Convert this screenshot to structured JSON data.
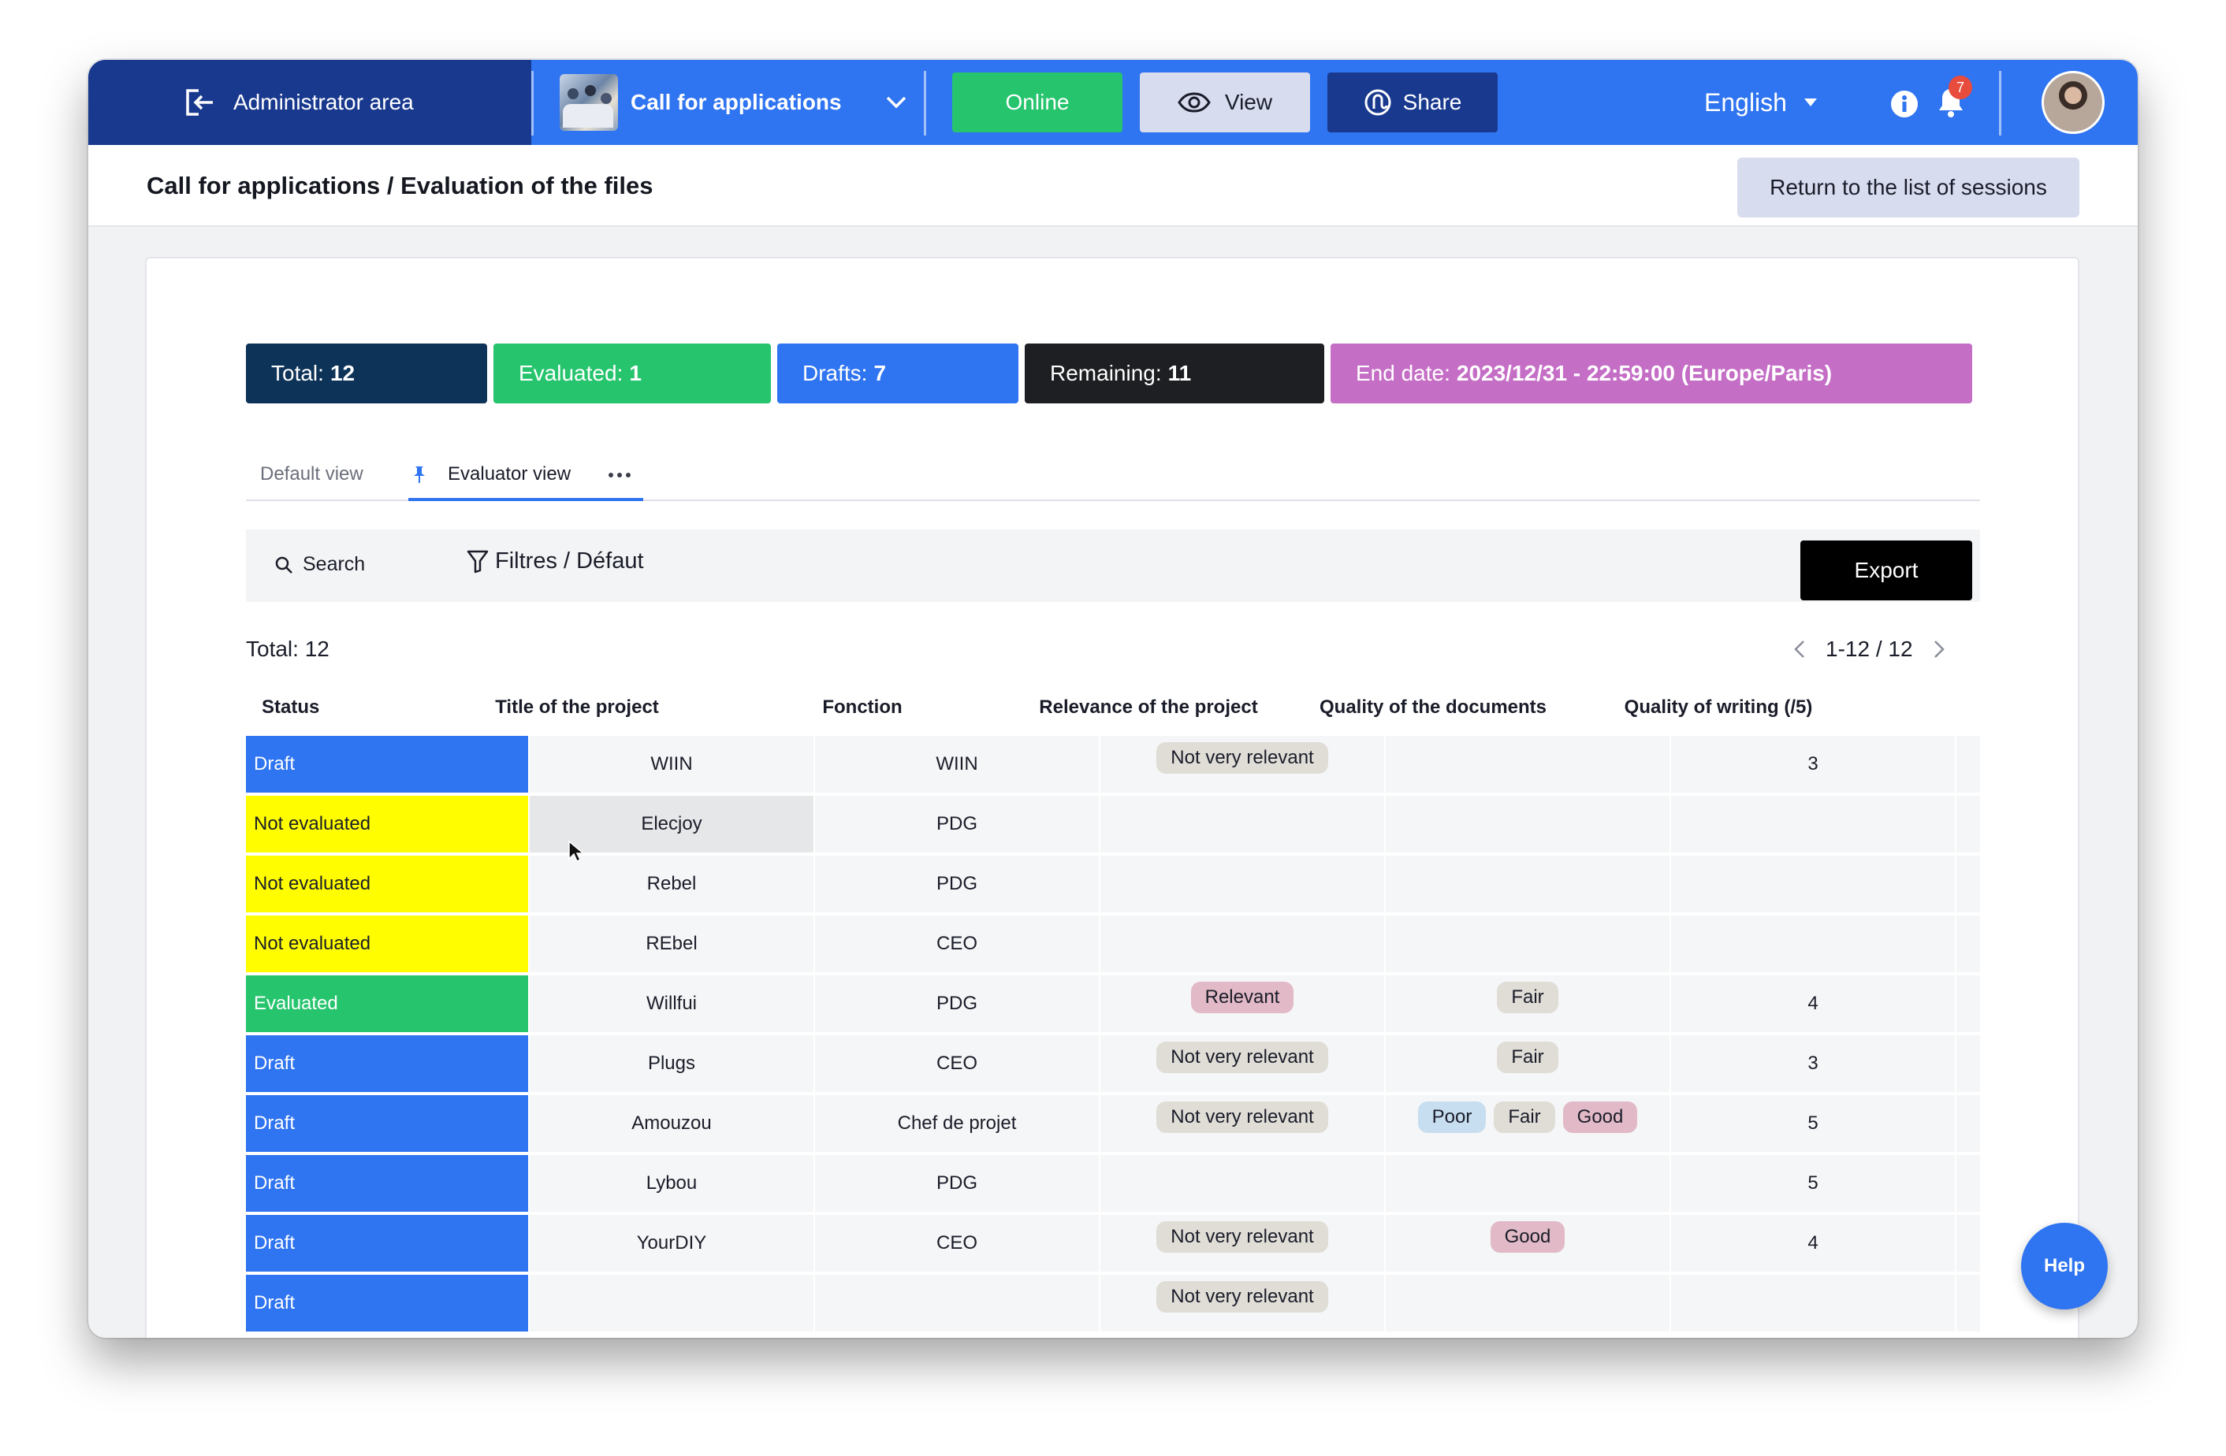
{
  "topbar": {
    "admin_label": "Administrator area",
    "call_label": "Call for applications",
    "online_label": "Online",
    "view_label": "View",
    "share_label": "Share",
    "language": "English",
    "notification_count": "7"
  },
  "header": {
    "breadcrumb": "Call for applications / Evaluation of the files",
    "return_label": "Return to the list of sessions"
  },
  "stats": {
    "total_label": "Total:",
    "total_value": "12",
    "evaluated_label": "Evaluated:",
    "evaluated_value": "1",
    "drafts_label": "Drafts:",
    "drafts_value": "7",
    "remaining_label": "Remaining:",
    "remaining_value": "11",
    "end_label": "End date:",
    "end_value": "2023/12/31 - 22:59:00 (Europe/Paris)"
  },
  "tabs": {
    "default": "Default view",
    "evaluator": "Evaluator view"
  },
  "toolbar": {
    "search_label": "Search",
    "filters_label": "Filtres / Défaut",
    "export_label": "Export"
  },
  "list": {
    "total_text": "Total: 12",
    "pagination": "1-12 / 12"
  },
  "table": {
    "columns": [
      "Status",
      "Title of the project",
      "Fonction",
      "Relevance of the project",
      "Quality of the documents",
      "Quality of writing (/5)"
    ],
    "rows": [
      {
        "status": "Draft",
        "title": "WIIN",
        "fonction": "WIIN",
        "relevance": "Not very relevant",
        "quality": [],
        "writing": "3"
      },
      {
        "status": "Not evaluated",
        "title": "Elecjoy",
        "fonction": "PDG",
        "relevance": "",
        "quality": [],
        "writing": ""
      },
      {
        "status": "Not evaluated",
        "title": "Rebel",
        "fonction": "PDG",
        "relevance": "",
        "quality": [],
        "writing": ""
      },
      {
        "status": "Not evaluated",
        "title": "REbel",
        "fonction": "CEO",
        "relevance": "",
        "quality": [],
        "writing": ""
      },
      {
        "status": "Evaluated",
        "title": "Willfui",
        "fonction": "PDG",
        "relevance": "Relevant",
        "quality": [
          "Fair"
        ],
        "writing": "4"
      },
      {
        "status": "Draft",
        "title": "Plugs",
        "fonction": "CEO",
        "relevance": "Not very relevant",
        "quality": [
          "Fair"
        ],
        "writing": "3"
      },
      {
        "status": "Draft",
        "title": "Amouzou",
        "fonction": "Chef de projet",
        "relevance": "Not very relevant",
        "quality": [
          "Poor",
          "Fair",
          "Good"
        ],
        "writing": "5"
      },
      {
        "status": "Draft",
        "title": "Lybou",
        "fonction": "PDG",
        "relevance": "",
        "quality": [],
        "writing": "5"
      },
      {
        "status": "Draft",
        "title": "YourDIY",
        "fonction": "CEO",
        "relevance": "Not very relevant",
        "quality": [
          "Good"
        ],
        "writing": "4"
      },
      {
        "status": "Draft",
        "title": "",
        "fonction": "",
        "relevance": "Not very relevant",
        "quality": [],
        "writing": ""
      }
    ]
  },
  "colors": {
    "Draft": "#2f74f0",
    "Not evaluated": "#fffd00",
    "Evaluated": "#27c46e",
    "Not very relevant": "#e0ddd7",
    "Relevant": "#e2b9c6",
    "Fair": "#e0ddd7",
    "Poor": "#c7def0",
    "Good": "#e2b9c6"
  },
  "help_label": "Help"
}
